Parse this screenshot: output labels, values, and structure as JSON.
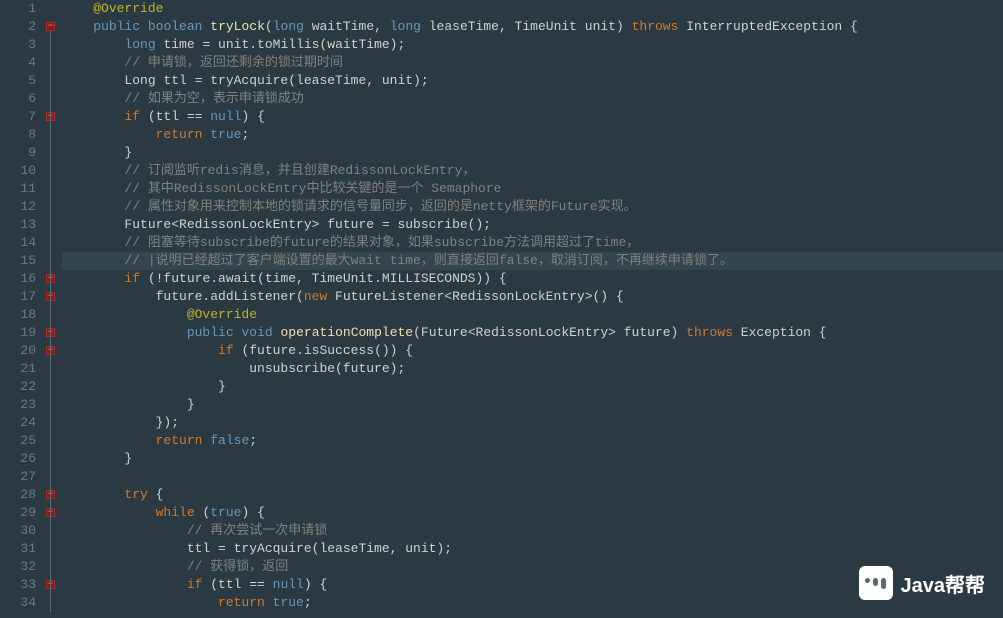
{
  "watermark": {
    "label": "Java帮帮"
  },
  "lines": [
    {
      "n": 1,
      "fold": false,
      "html": "    <span class='annot'>@Override</span>"
    },
    {
      "n": 2,
      "fold": true,
      "html": "    <span class='kw'>public</span> <span class='kw'>boolean</span> <span class='method'>tryLock</span>(<span class='kw'>long</span> waitTime, <span class='kw'>long</span> leaseTime, TimeUnit unit) <span class='kw2'>throws</span> InterruptedException {"
    },
    {
      "n": 3,
      "fold": false,
      "html": "        <span class='kw'>long</span> time = unit.toMillis(waitTime);"
    },
    {
      "n": 4,
      "fold": false,
      "html": "        <span class='comment'>// 申请锁，返回还剩余的锁过期时间</span>"
    },
    {
      "n": 5,
      "fold": false,
      "html": "        Long ttl = tryAcquire(leaseTime, unit);"
    },
    {
      "n": 6,
      "fold": false,
      "html": "        <span class='comment'>// 如果为空，表示申请锁成功</span>"
    },
    {
      "n": 7,
      "fold": true,
      "html": "        <span class='kw2'>if</span> (ttl == <span class='kw'>null</span>) {"
    },
    {
      "n": 8,
      "fold": false,
      "html": "            <span class='kw2'>return</span> <span class='kw'>true</span>;"
    },
    {
      "n": 9,
      "fold": false,
      "html": "        }"
    },
    {
      "n": 10,
      "fold": false,
      "html": "        <span class='comment'>// 订阅监听redis消息，并且创建RedissonLockEntry，</span>"
    },
    {
      "n": 11,
      "fold": false,
      "html": "        <span class='comment'>// 其中RedissonLockEntry中比较关键的是一个 Semaphore</span>"
    },
    {
      "n": 12,
      "fold": false,
      "html": "        <span class='comment'>// 属性对象用来控制本地的锁请求的信号量同步，返回的是netty框架的Future实现。</span>"
    },
    {
      "n": 13,
      "fold": false,
      "html": "        Future&lt;RedissonLockEntry&gt; future = subscribe();"
    },
    {
      "n": 14,
      "fold": false,
      "html": "        <span class='comment'>// 阻塞等待subscribe的future的结果对象，如果subscribe方法调用超过了time，</span>"
    },
    {
      "n": 15,
      "fold": false,
      "hl": true,
      "html": "        <span class='comment'>// |说明已经超过了客户端设置的最大wait time，则直接返回false，取消订阅，不再继续申请锁了。</span>"
    },
    {
      "n": 16,
      "fold": true,
      "html": "        <span class='kw2'>if</span> (!future.await(time, TimeUnit.MILLISECONDS)) {"
    },
    {
      "n": 17,
      "fold": true,
      "html": "            future.addListener(<span class='kw2'>new</span> FutureListener&lt;RedissonLockEntry&gt;() {"
    },
    {
      "n": 18,
      "fold": false,
      "html": "                <span class='annot'>@Override</span>"
    },
    {
      "n": 19,
      "fold": true,
      "html": "                <span class='kw'>public</span> <span class='kw'>void</span> <span class='method'>operationComplete</span>(Future&lt;RedissonLockEntry&gt; future) <span class='kw2'>throws</span> Exception {"
    },
    {
      "n": 20,
      "fold": true,
      "html": "                    <span class='kw2'>if</span> (future.isSuccess()) {"
    },
    {
      "n": 21,
      "fold": false,
      "html": "                        unsubscribe(future);"
    },
    {
      "n": 22,
      "fold": false,
      "html": "                    }"
    },
    {
      "n": 23,
      "fold": false,
      "html": "                }"
    },
    {
      "n": 24,
      "fold": false,
      "html": "            });"
    },
    {
      "n": 25,
      "fold": false,
      "html": "            <span class='kw2'>return</span> <span class='kw'>false</span>;"
    },
    {
      "n": 26,
      "fold": false,
      "html": "        }"
    },
    {
      "n": 27,
      "fold": false,
      "html": ""
    },
    {
      "n": 28,
      "fold": true,
      "html": "        <span class='kw2'>try</span> {"
    },
    {
      "n": 29,
      "fold": true,
      "html": "            <span class='kw2'>while</span> (<span class='kw'>true</span>) {"
    },
    {
      "n": 30,
      "fold": false,
      "html": "                <span class='comment'>// 再次尝试一次申请锁</span>"
    },
    {
      "n": 31,
      "fold": false,
      "html": "                ttl = tryAcquire(leaseTime, unit);"
    },
    {
      "n": 32,
      "fold": false,
      "html": "                <span class='comment'>// 获得锁，返回</span>"
    },
    {
      "n": 33,
      "fold": true,
      "html": "                <span class='kw2'>if</span> (ttl == <span class='kw'>null</span>) {"
    },
    {
      "n": 34,
      "fold": false,
      "html": "                    <span class='kw2'>return</span> <span class='kw'>true</span>;"
    }
  ]
}
